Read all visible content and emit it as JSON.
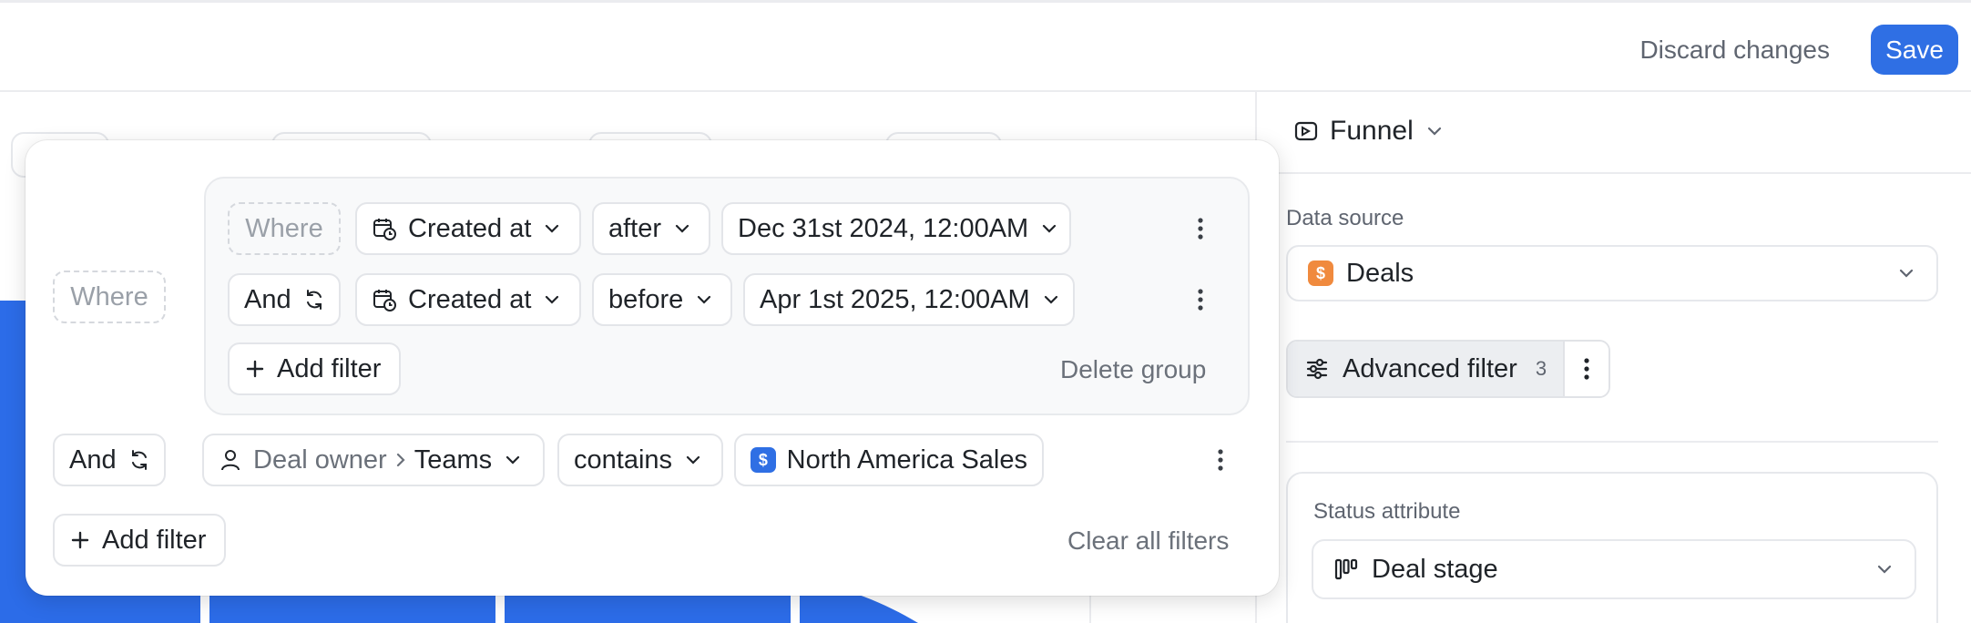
{
  "header": {
    "discard_label": "Discard changes",
    "save_label": "Save"
  },
  "right_panel": {
    "view_type": "Funnel",
    "data_source_label": "Data source",
    "data_source_value": "Deals",
    "advanced_filter_label": "Advanced filter",
    "advanced_filter_count": "3",
    "status_attribute_label": "Status attribute",
    "status_attribute_value": "Deal stage"
  },
  "filter": {
    "top_where": "Where",
    "group": {
      "rows": [
        {
          "connector": "Where",
          "attribute": "Created at",
          "operator": "after",
          "value": "Dec 31st 2024, 12:00AM"
        },
        {
          "connector": "And",
          "attribute": "Created at",
          "operator": "before",
          "value": "Apr 1st 2025, 12:00AM"
        }
      ],
      "add_filter_label": "Add filter",
      "delete_group_label": "Delete group"
    },
    "row3": {
      "connector": "And",
      "attribute_parent": "Deal owner",
      "attribute_child": "Teams",
      "operator": "contains",
      "value": "North America Sales"
    },
    "add_filter_label": "Add filter",
    "clear_all_label": "Clear all filters"
  },
  "colors": {
    "accent": "#2f6fe4",
    "chart_bar": "#2c6ce8",
    "deal_icon": "#f08a3e"
  }
}
